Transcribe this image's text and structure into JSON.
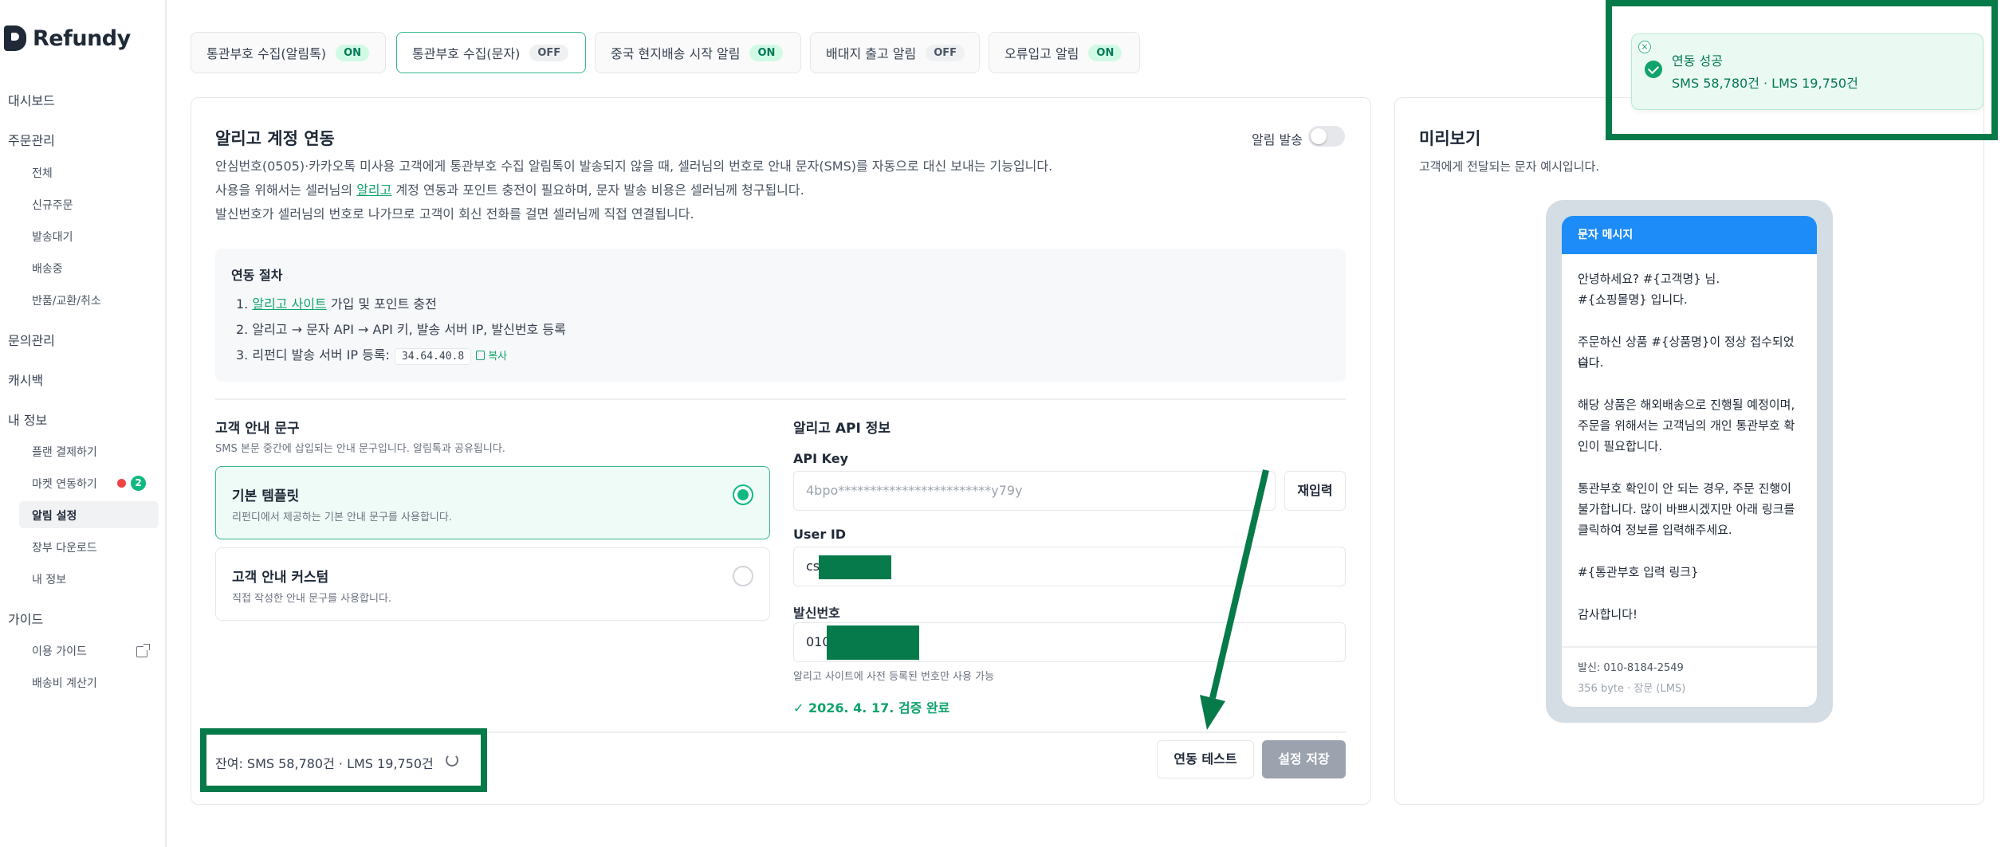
{
  "brand": {
    "name": "Refundy"
  },
  "sidebar": {
    "sections": [
      {
        "label": "대시보드"
      },
      {
        "label": "주문관리"
      },
      {
        "label": "문의관리"
      },
      {
        "label": "캐시백"
      },
      {
        "label": "내 정보"
      },
      {
        "label": "가이드"
      }
    ],
    "order_items": [
      "전체",
      "신규주문",
      "발송대기",
      "배송중",
      "반품/교환/취소"
    ],
    "info_items": [
      "플랜 결제하기",
      "마켓 연동하기",
      "알림 설정",
      "장부 다운로드",
      "내 정보"
    ],
    "market_badge": "2",
    "guide_items": [
      "이용 가이드",
      "배송비 계산기"
    ]
  },
  "tabs": [
    {
      "label": "통관부호 수집(알림톡)",
      "status": "ON"
    },
    {
      "label": "통관부호 수집(문자)",
      "status": "OFF"
    },
    {
      "label": "중국 현지배송 시작 알림",
      "status": "ON"
    },
    {
      "label": "배대지 출고 알림",
      "status": "OFF"
    },
    {
      "label": "오류입고 알림",
      "status": "ON"
    }
  ],
  "main": {
    "title": "알리고 계정 연동",
    "toggle_label": "알림 발송",
    "desc1": "안심번호(0505)·카카오톡 미사용 고객에게 통관부호 수집 알림톡이 발송되지 않을 때, 셀러님의 번호로 안내 문자(SMS)를 자동으로 대신 보내는 기능입니다.",
    "desc2_pre": "사용을 위해서는 셀러님의 ",
    "desc2_link": "알리고",
    "desc2_post": " 계정 연동과 포인트 충전이 필요하며, 문자 발송 비용은 셀러님께 청구됩니다.",
    "desc3": "발신번호가 셀러님의 번호로 나가므로 고객이 회신 전화를 걸면 셀러님께 직접 연결됩니다.",
    "procedure": {
      "title": "연동 절차",
      "step1_num": "1.",
      "step1_link": "알리고 사이트",
      "step1_text": " 가입 및 포인트 충전",
      "step2": "2. 알리고 → 문자 API → API 키, 발송 서버 IP, 발신번호 등록",
      "step3": "3. 리펀디 발송 서버 IP 등록:",
      "ip": "34.64.40.8",
      "copy": "복사"
    },
    "guide_text": {
      "title": "고객 안내 문구",
      "desc": "SMS 본문 중간에 삽입되는 안내 문구입니다. 알림톡과 공유됩니다.",
      "options": [
        {
          "title": "기본 템플릿",
          "desc": "리펀디에서 제공하는 기본 안내 문구를 사용합니다."
        },
        {
          "title": "고객 안내 커스텀",
          "desc": "직접 작성한 안내 문구를 사용합니다."
        }
      ]
    },
    "api": {
      "title": "알리고 API 정보",
      "api_key_label": "API Key",
      "api_key_value": "4bpo************************y79y",
      "reenter": "재입력",
      "user_id_label": "User ID",
      "user_id_value": "cs",
      "sender_label": "발신번호",
      "sender_value": "010",
      "sender_hint": "알리고 사이트에 사전 등록된 번호만 사용 가능",
      "verified": "✓ 2026. 4. 17. 검증 완료"
    },
    "balance": "잔여: SMS 58,780건 · LMS 19,750건",
    "test_button": "연동 테스트",
    "save_button": "설정 저장"
  },
  "preview": {
    "title": "미리보기",
    "desc": "고객에게 전달되는 문자 예시입니다.",
    "phone_header": "문자 메시지",
    "lines": [
      "안녕하세요? #{고객명} 님.",
      "#{쇼핑몰명} 입니다.",
      "주문하신 상품 #{상품명}이 정상 접수되었습",
      "니다.",
      "해당 상품은 해외배송으로 진행될 예정이며,",
      "주문을 위해서는 고객님의 개인 통관부호 확",
      "인이 필요합니다.",
      "통관부호 확인이 안 되는 경우, 주문 진행이",
      "불가합니다. 많이 바쁘시겠지만 아래 링크를",
      "클릭하여 정보를 입력해주세요.",
      "#{통관부호 입력 링크}",
      "감사합니다!"
    ],
    "sender": "발신: 010-8184-2549",
    "bytes": "356 byte · 장문 (LMS)"
  },
  "toast": {
    "title": "연동 성공",
    "subtitle": "SMS 58,780건 · LMS 19,750건",
    "close": "×"
  },
  "colors": {
    "accent": "#10b981",
    "highlight": "#077a4a",
    "phone_header": "#1d8cf8"
  }
}
